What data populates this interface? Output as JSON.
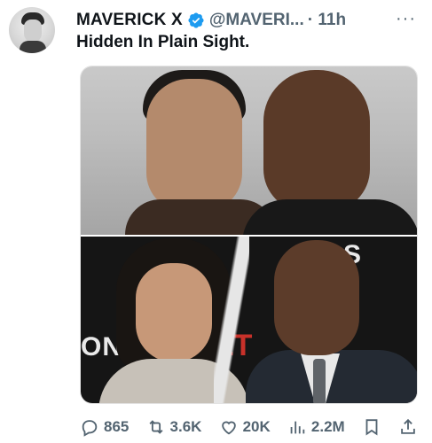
{
  "author": {
    "display_name": "MAVERICK X",
    "handle": "@MAVERI...",
    "timestamp": "· 11h",
    "verified": true,
    "verified_color": "#1d9bf0"
  },
  "tweet": {
    "text": "Hidden In Plain Sight."
  },
  "media": {
    "top_image": "two-men-photo",
    "bottom_image": "couple-torn-photo",
    "bg_text_left": "ONES",
    "bg_text_mid": "ET",
    "bg_text_right": "S"
  },
  "actions": {
    "replies": "865",
    "reposts": "3.6K",
    "likes": "20K",
    "views": "2.2M"
  },
  "colors": {
    "text": "#0f1419",
    "muted": "#536471",
    "accent": "#1d9bf0"
  }
}
